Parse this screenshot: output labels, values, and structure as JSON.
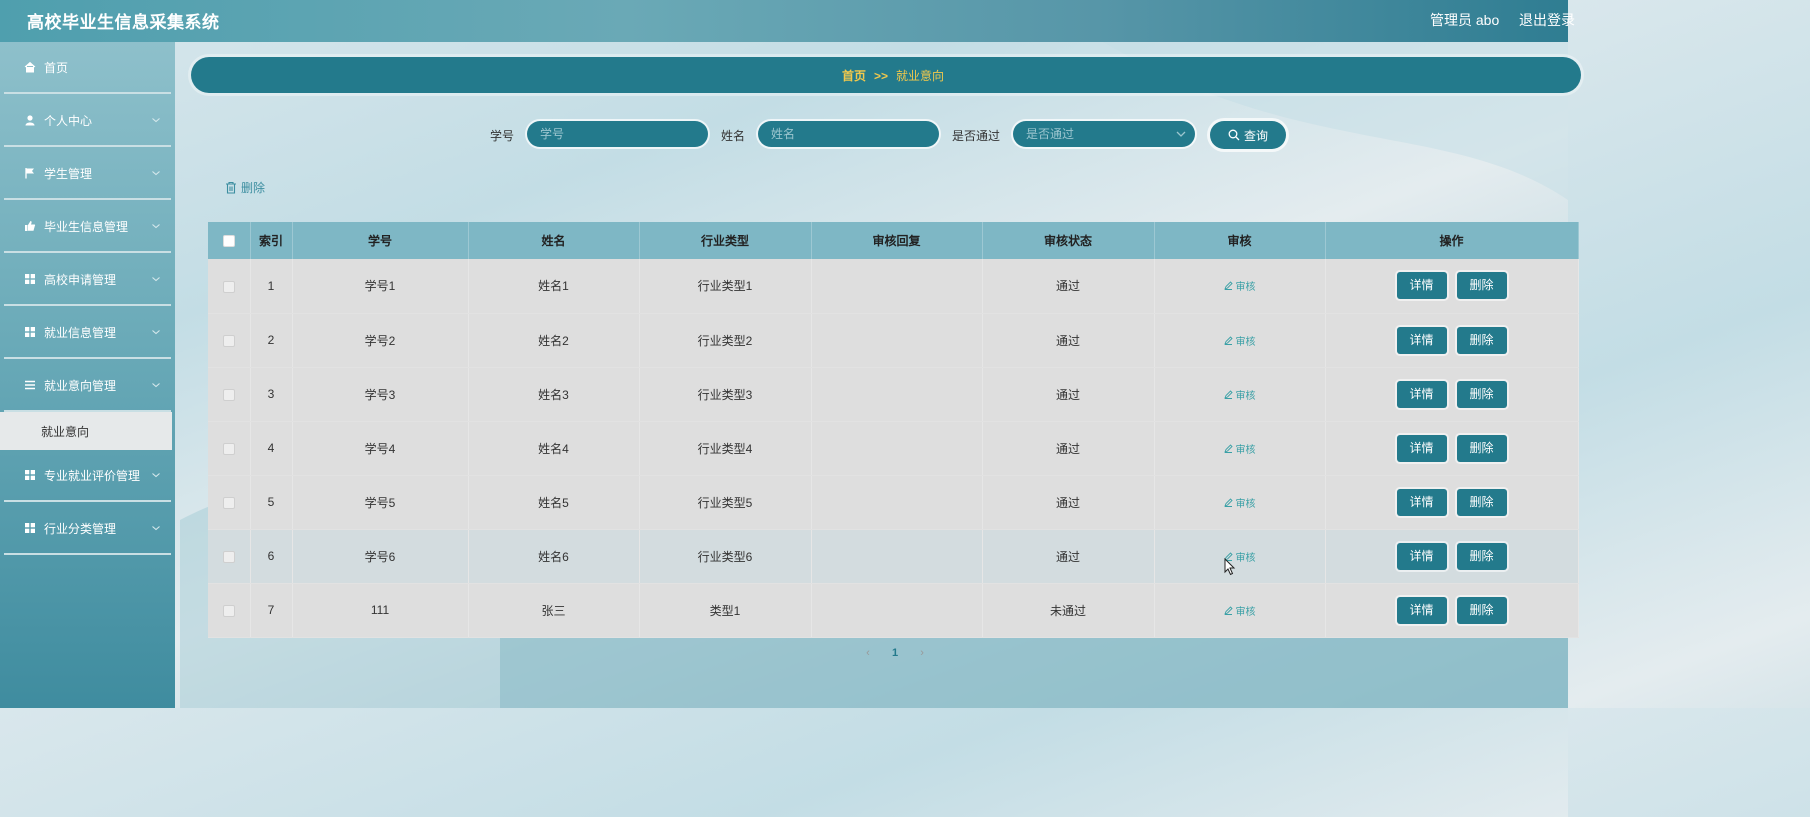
{
  "header": {
    "app_title": "高校毕业生信息采集系统",
    "admin_label": "管理员 abo",
    "logout_label": "退出登录"
  },
  "sidebar": {
    "items": [
      {
        "label": "首页",
        "icon": "home-icon",
        "has_chevron": false
      },
      {
        "label": "个人中心",
        "icon": "user-icon",
        "has_chevron": true
      },
      {
        "label": "学生管理",
        "icon": "flag-icon",
        "has_chevron": true
      },
      {
        "label": "毕业生信息管理",
        "icon": "thumb-icon",
        "has_chevron": true
      },
      {
        "label": "高校申请管理",
        "icon": "grid-icon",
        "has_chevron": true
      },
      {
        "label": "就业信息管理",
        "icon": "grid-icon",
        "has_chevron": true
      },
      {
        "label": "就业意向管理",
        "icon": "list-icon",
        "has_chevron": true
      },
      {
        "label": "专业就业评价管理",
        "icon": "grid-icon",
        "has_chevron": true
      },
      {
        "label": "行业分类管理",
        "icon": "grid-icon",
        "has_chevron": true
      }
    ],
    "active_sub": "就业意向"
  },
  "breadcrumb": {
    "home": "首页",
    "separator": ">>",
    "current": "就业意向"
  },
  "search": {
    "student_no_label": "学号",
    "student_no_placeholder": "学号",
    "name_label": "姓名",
    "name_placeholder": "姓名",
    "passed_label": "是否通过",
    "passed_placeholder": "是否通过",
    "button_label": "查询"
  },
  "toolbar": {
    "delete_label": "删除"
  },
  "table": {
    "headers": [
      "索引",
      "学号",
      "姓名",
      "行业类型",
      "审核回复",
      "审核状态",
      "审核",
      "操作"
    ],
    "audit_link": "审核",
    "detail_btn": "详情",
    "delete_btn": "删除",
    "rows": [
      {
        "index": "1",
        "no": "学号1",
        "name": "姓名1",
        "industry": "行业类型1",
        "reply": "",
        "status": "通过"
      },
      {
        "index": "2",
        "no": "学号2",
        "name": "姓名2",
        "industry": "行业类型2",
        "reply": "",
        "status": "通过"
      },
      {
        "index": "3",
        "no": "学号3",
        "name": "姓名3",
        "industry": "行业类型3",
        "reply": "",
        "status": "通过"
      },
      {
        "index": "4",
        "no": "学号4",
        "name": "姓名4",
        "industry": "行业类型4",
        "reply": "",
        "status": "通过"
      },
      {
        "index": "5",
        "no": "学号5",
        "name": "姓名5",
        "industry": "行业类型5",
        "reply": "",
        "status": "通过"
      },
      {
        "index": "6",
        "no": "学号6",
        "name": "姓名6",
        "industry": "行业类型6",
        "reply": "",
        "status": "通过"
      },
      {
        "index": "7",
        "no": "111",
        "name": "张三",
        "industry": "类型1",
        "reply": "",
        "status": "未通过"
      }
    ]
  },
  "pagination": {
    "prev": "‹",
    "current_page": "1",
    "next": "›"
  },
  "colors": {
    "accent": "#237a8c",
    "crumb_text": "#f2c94c",
    "header_th": "#7eb7c5"
  }
}
